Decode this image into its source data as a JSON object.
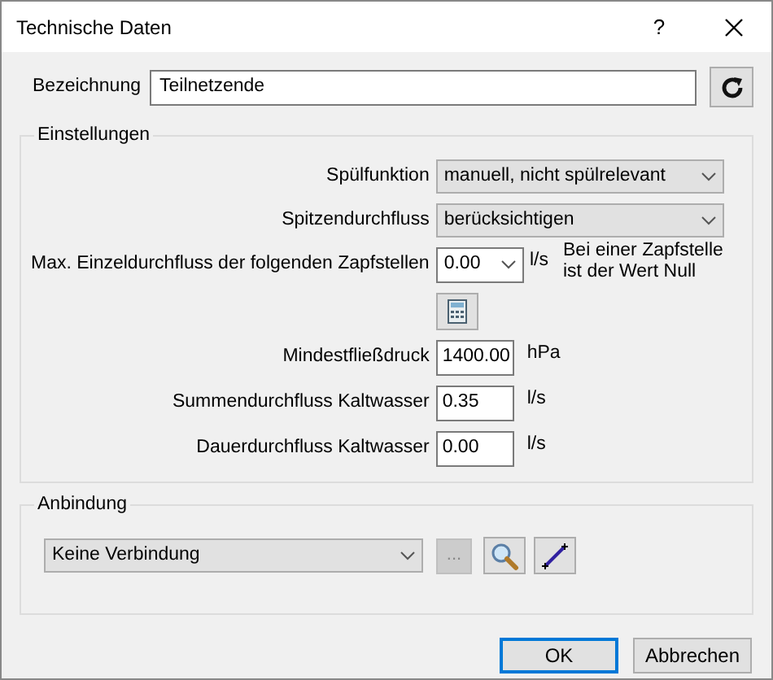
{
  "window": {
    "title": "Technische Daten",
    "help": "?"
  },
  "name": {
    "label": "Bezeichnung",
    "value": "Teilnetzende"
  },
  "settings": {
    "title": "Einstellungen",
    "rows": [
      {
        "kind": "select",
        "label": "Spülfunktion",
        "value": "manuell, nicht spülrelevant"
      },
      {
        "kind": "select",
        "label": "Spitzendurchfluss",
        "value": "berücksichtigen"
      },
      {
        "kind": "combo",
        "label": "Max. Einzeldurchfluss der folgenden Zapfstellen",
        "value": "0.00",
        "unit": "l/s",
        "note": "Bei einer Zapfstelle ist der Wert Null"
      },
      {
        "kind": "tool"
      },
      {
        "kind": "input",
        "label": "Mindestfließdruck",
        "value": "1400.00",
        "unit": "hPa"
      },
      {
        "kind": "input",
        "label": "Summendurchfluss Kaltwasser",
        "value": "0.35",
        "unit": "l/s"
      },
      {
        "kind": "input",
        "label": "Dauerdurchfluss Kaltwasser",
        "value": "0.00",
        "unit": "l/s"
      }
    ]
  },
  "connection": {
    "title": "Anbindung",
    "value": "Keine Verbindung",
    "browse": {
      "label": "...",
      "disabled": true
    }
  },
  "buttons": [
    {
      "label": "OK",
      "default": true
    },
    {
      "label": "Abbrechen",
      "default": false
    }
  ]
}
